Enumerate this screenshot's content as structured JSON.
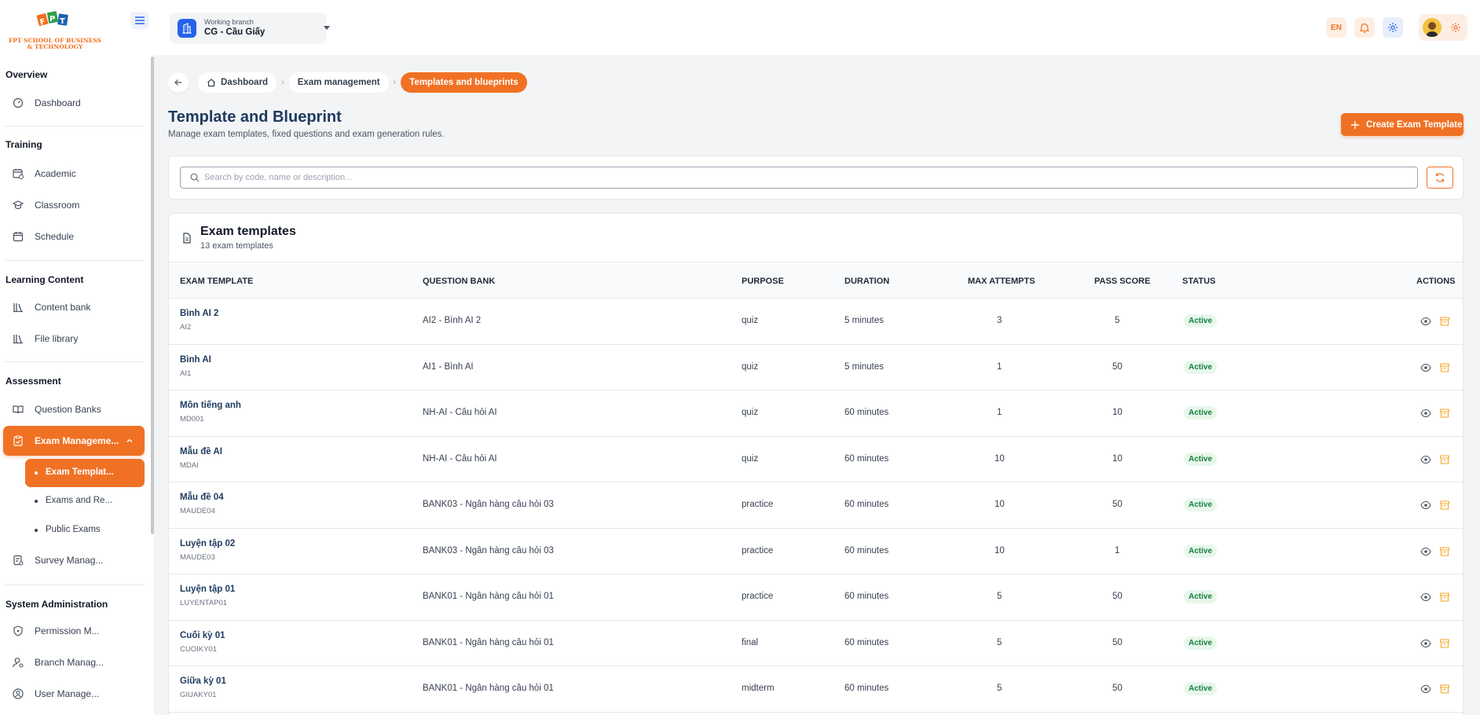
{
  "app": {
    "logo_text_line1": "FPT SCHOOL OF BUSINESS",
    "logo_text_line2": "& TECHNOLOGY"
  },
  "sidebar": {
    "sections": {
      "overview": "Overview",
      "training": "Training",
      "learning": "Learning Content",
      "assessment": "Assessment",
      "sysadmin": "System Administration"
    },
    "items": {
      "dashboard": "Dashboard",
      "academic": "Academic",
      "classroom": "Classroom",
      "schedule": "Schedule",
      "content_bank": "Content bank",
      "file_library": "File library",
      "question_banks": "Question Banks",
      "exam_management": "Exam Manageme...",
      "exam_templates": "Exam Templat...",
      "exams_and_results": "Exams and Re...",
      "public_exams": "Public Exams",
      "survey_management": "Survey Manag...",
      "permission_management": "Permission M...",
      "branch_management": "Branch Manag...",
      "user_management": "User Manage..."
    }
  },
  "topbar": {
    "branch_caption": "Working branch",
    "branch_value": "CG - Cầu Giấy",
    "language": "EN"
  },
  "breadcrumb": {
    "items": [
      "Dashboard",
      "Exam management",
      "Templates and blueprints"
    ]
  },
  "page": {
    "title": "Template and Blueprint",
    "subtitle": "Manage exam templates, fixed questions and exam generation rules.",
    "create_button": "Create Exam Template"
  },
  "search": {
    "placeholder": "Search by code, name or description..."
  },
  "table": {
    "title": "Exam templates",
    "count_text": "13 exam templates",
    "columns": [
      "EXAM TEMPLATE",
      "QUESTION BANK",
      "PURPOSE",
      "DURATION",
      "MAX ATTEMPTS",
      "PASS SCORE",
      "STATUS",
      "ACTIONS"
    ],
    "rows": [
      {
        "name": "Bình AI 2",
        "code": "AI2",
        "bank": "AI2 - Bình AI 2",
        "purpose": "quiz",
        "duration": "5 minutes",
        "attempts": "3",
        "pass": "5",
        "status": "Active"
      },
      {
        "name": "Bình AI",
        "code": "AI1",
        "bank": "AI1 - Bình AI",
        "purpose": "quiz",
        "duration": "5 minutes",
        "attempts": "1",
        "pass": "50",
        "status": "Active"
      },
      {
        "name": "Môn tiếng anh",
        "code": "MD001",
        "bank": "NH-AI - Câu hỏi AI",
        "purpose": "quiz",
        "duration": "60 minutes",
        "attempts": "1",
        "pass": "10",
        "status": "Active"
      },
      {
        "name": "Mẫu đề AI",
        "code": "MDAI",
        "bank": "NH-AI - Câu hỏi AI",
        "purpose": "quiz",
        "duration": "60 minutes",
        "attempts": "10",
        "pass": "10",
        "status": "Active"
      },
      {
        "name": "Mẫu đề 04",
        "code": "MAUDE04",
        "bank": "BANK03 - Ngân hàng câu hỏi 03",
        "purpose": "practice",
        "duration": "60 minutes",
        "attempts": "10",
        "pass": "50",
        "status": "Active"
      },
      {
        "name": "Luyện tập 02",
        "code": "MAUDE03",
        "bank": "BANK03 - Ngân hàng câu hỏi 03",
        "purpose": "practice",
        "duration": "60 minutes",
        "attempts": "10",
        "pass": "1",
        "status": "Active"
      },
      {
        "name": "Luyện tập 01",
        "code": "LUYENTAP01",
        "bank": "BANK01 - Ngân hàng câu hỏi 01",
        "purpose": "practice",
        "duration": "60 minutes",
        "attempts": "5",
        "pass": "50",
        "status": "Active"
      },
      {
        "name": "Cuối kỳ 01",
        "code": "CUOIKY01",
        "bank": "BANK01 - Ngân hàng câu hỏi 01",
        "purpose": "final",
        "duration": "60 minutes",
        "attempts": "5",
        "pass": "50",
        "status": "Active"
      },
      {
        "name": "Giữa kỳ 01",
        "code": "GIUAKY01",
        "bank": "BANK01 - Ngân hàng câu hỏi 01",
        "purpose": "midterm",
        "duration": "60 minutes",
        "attempts": "5",
        "pass": "50",
        "status": "Active"
      }
    ]
  },
  "colors": {
    "accent": "#f07124",
    "brand_blue": "#1e3a5f",
    "status_active_bg": "#e7f7ec",
    "status_active_text": "#15803d",
    "archive_icon": "#f5a623"
  }
}
